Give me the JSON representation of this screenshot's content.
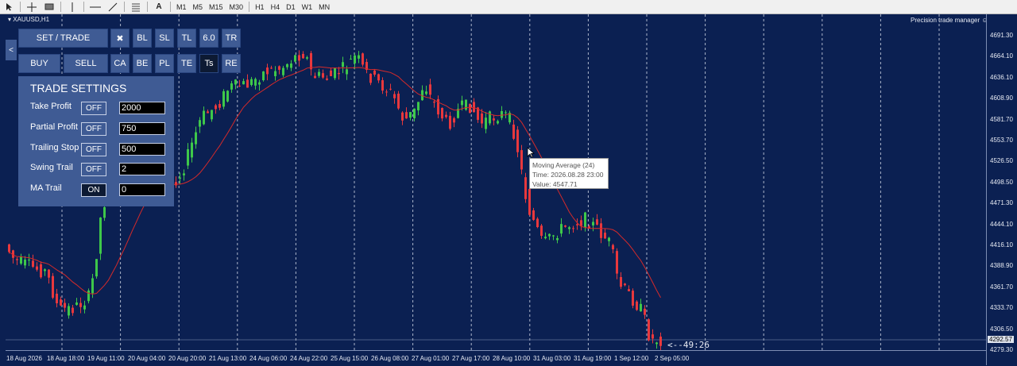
{
  "toolbar": {
    "tools": [
      "cursor-icon",
      "crosshair-icon",
      "rectangle-icon",
      "vertical-line-icon",
      "horizontal-line-icon",
      "trendline-icon",
      "fibonacci-icon",
      "text-icon"
    ],
    "text_tool_label": "A",
    "timeframes": [
      "M1",
      "M5",
      "M15",
      "M30",
      "H1",
      "H4",
      "D1",
      "W1",
      "MN"
    ]
  },
  "chart": {
    "symbol": "XAUUSD,H1",
    "indicator": "Precision  trade manager",
    "countdown": "<--49:26",
    "current_price": "4292.57",
    "price_ticks": [
      "4691.30",
      "4664.10",
      "4636.10",
      "4608.90",
      "4581.70",
      "4553.70",
      "4526.50",
      "4498.50",
      "4471.30",
      "4444.10",
      "4416.10",
      "4388.90",
      "4361.70",
      "4333.70",
      "4306.50",
      "4279.30"
    ],
    "time_ticks": [
      "18 Aug 2026",
      "18 Aug 18:00",
      "19 Aug 11:00",
      "20 Aug 04:00",
      "20 Aug 20:00",
      "21 Aug 13:00",
      "24 Aug 06:00",
      "24 Aug 22:00",
      "25 Aug 15:00",
      "26 Aug 08:00",
      "27 Aug 01:00",
      "27 Aug 17:00",
      "28 Aug 10:00",
      "31 Aug 03:00",
      "31 Aug 19:00",
      "1 Sep 12:00",
      "2 Sep 05:00"
    ],
    "colors": {
      "background": "#0b2052",
      "bull": "#3ec84a",
      "bear": "#e8383d",
      "ma": "#d62a2a",
      "separator": "#c8cfe0"
    }
  },
  "tooltip": {
    "line1": "Moving Average (24)",
    "line2": "Time: 2026.08.28 23:00",
    "line3": "Value: 4547.71"
  },
  "panel": {
    "collapse": "<",
    "set_trade": "SET / TRADE",
    "close_icon": "✖",
    "row1": [
      "BL",
      "SL",
      "TL",
      "6.0",
      "TR"
    ],
    "buy": "BUY",
    "sell": "SELL",
    "row2": [
      "CA",
      "BE",
      "PL",
      "TE",
      "Ts",
      "RE"
    ],
    "settings_title": "TRADE SETTINGS",
    "settings": [
      {
        "label": "Take Profit",
        "state": "OFF",
        "value": "2000"
      },
      {
        "label": "Partial Profit",
        "state": "OFF",
        "value": "750"
      },
      {
        "label": "Trailing Stop",
        "state": "OFF",
        "value": "500"
      },
      {
        "label": "Swing Trail",
        "state": "OFF",
        "value": "2"
      },
      {
        "label": "MA Trail",
        "state": "ON",
        "value": "0"
      }
    ]
  }
}
